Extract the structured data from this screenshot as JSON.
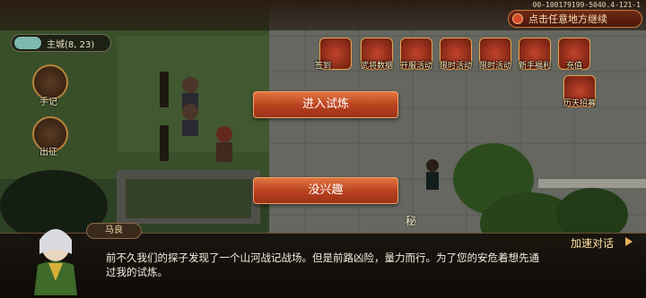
{
  "top_bar": {
    "build_id": "00-100179199-5040.4-121-1",
    "continue_label": "点击任意地方继续"
  },
  "minimap": {
    "location_label": "主城(8, 23)"
  },
  "side_buttons": [
    {
      "label": "手记",
      "icon": "book-icon"
    },
    {
      "label": "出征",
      "icon": "war-banner-icon"
    }
  ],
  "activities": [
    {
      "label": "签到",
      "icon": "character-icon"
    },
    {
      "label": "武将数据",
      "icon": "general-icon"
    },
    {
      "label": "开服活动",
      "icon": "treasure-icon"
    },
    {
      "label": "限时活动",
      "icon": "gift-icon"
    },
    {
      "label": "限时活动",
      "icon": "chest-icon"
    },
    {
      "label": "新手福利",
      "icon": "coin-icon"
    },
    {
      "label": "充值",
      "icon": "ingot-icon"
    },
    {
      "label": "历天招募",
      "icon": "recruit-icon"
    }
  ],
  "choices": {
    "enter_trial": "进入试炼",
    "not_interested": "没兴趣"
  },
  "map_marker": {
    "label": "秘"
  },
  "dialog": {
    "speaker": "马良",
    "text": "前不久我们的探子发现了一个山河战记战场。但是前路凶险，量力而行。为了您的安危着想先通过我的试炼。",
    "speed_label": "加速对话"
  },
  "colors": {
    "button_orange": "#d25a2c",
    "dialog_bg": "#18120e",
    "accent_gold": "#e8b35a"
  }
}
